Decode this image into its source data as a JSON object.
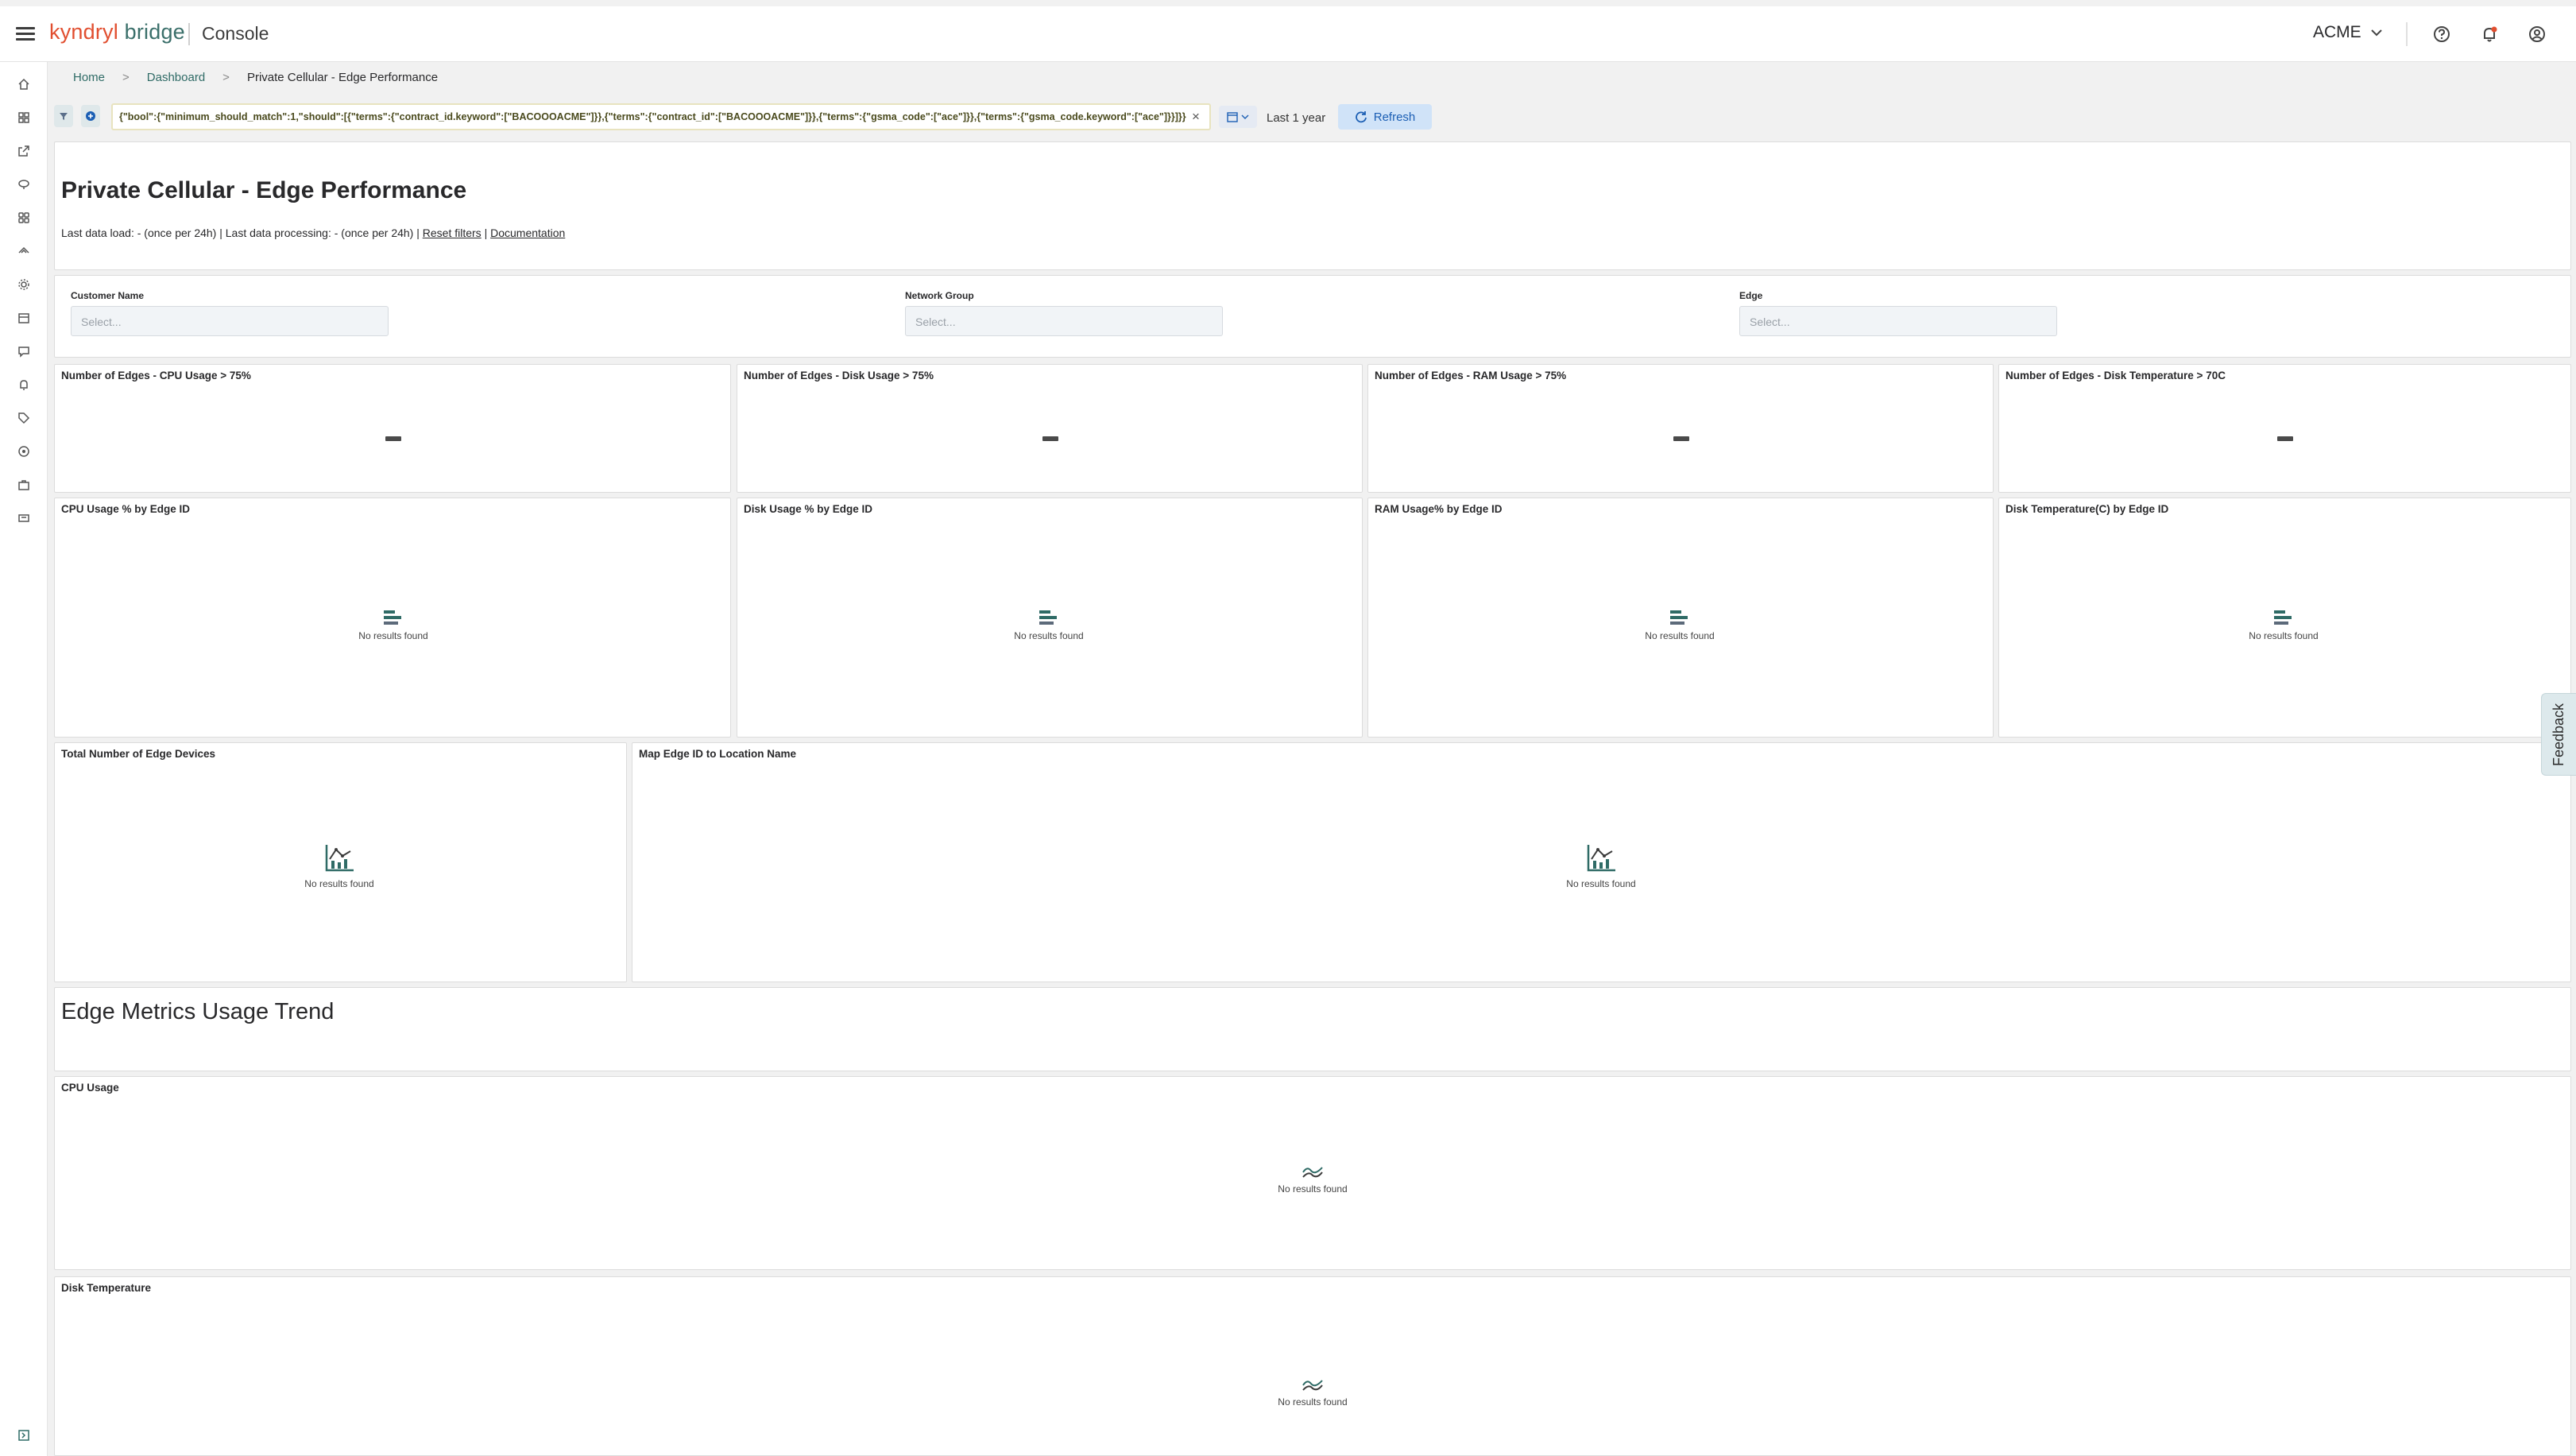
{
  "header": {
    "logo_part1": "kyndryl",
    "logo_part2": "bridge",
    "app": "Console",
    "account": "ACME"
  },
  "breadcrumb": {
    "home": "Home",
    "dashboard": "Dashboard",
    "current": "Private Cellular - Edge Performance",
    "separator": ">"
  },
  "filter_bar": {
    "query": "{\"bool\":{\"minimum_should_match\":1,\"should\":[{\"terms\":{\"contract_id.keyword\":[\"BACOOOACME\"]}},{\"terms\":{\"contract_id\":[\"BACOOOACME\"]}},{\"terms\":{\"gsma_code\":[\"ace\"]}},{\"terms\":{\"gsma_code.keyword\":[\"ace\"]}}]}}",
    "clear": "×",
    "time_range": "Last 1 year",
    "refresh": "Refresh"
  },
  "dashboard": {
    "title": "Private Cellular - Edge Performance",
    "meta": {
      "load": "Last data load: - (once per 24h) | Last data processing: - (once per 24h) |",
      "reset": "Reset filters",
      "pipe": "|",
      "docs": "Documentation"
    }
  },
  "controls": [
    {
      "label": "Customer Name",
      "placeholder": "Select..."
    },
    {
      "label": "Network Group",
      "placeholder": "Select..."
    },
    {
      "label": "Edge",
      "placeholder": "Select..."
    }
  ],
  "metrics": [
    {
      "title": "Number of Edges - CPU Usage > 75%",
      "value": "-"
    },
    {
      "title": "Number of Edges - Disk Usage > 75%",
      "value": "-"
    },
    {
      "title": "Number of Edges - RAM Usage > 75%",
      "value": "-"
    },
    {
      "title": "Number of Edges - Disk Temperature > 70C",
      "value": "-"
    }
  ],
  "bar_panels": [
    {
      "title": "CPU Usage % by Edge ID"
    },
    {
      "title": "Disk Usage % by Edge ID"
    },
    {
      "title": "RAM Usage% by Edge ID"
    },
    {
      "title": "Disk Temperature(C) by Edge ID"
    }
  ],
  "wide_panels": [
    {
      "title": "Total Number of Edge Devices"
    },
    {
      "title": "Map Edge ID to Location Name"
    }
  ],
  "section_heading": "Edge Metrics Usage Trend",
  "trend_panels": [
    {
      "title": "CPU Usage"
    },
    {
      "title": "Disk Temperature"
    }
  ],
  "empty_text": "No results found",
  "feedback": "Feedback",
  "colors": {
    "brand_red": "#e14e2f",
    "brand_teal": "#3a6f6a",
    "link": "#2f6b66",
    "refresh_bg": "#d0e3f8",
    "refresh_text": "#1c5fb4"
  }
}
